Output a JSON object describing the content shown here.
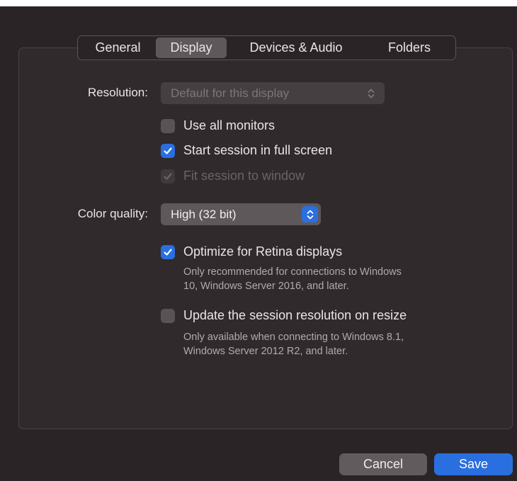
{
  "tabs": {
    "general": "General",
    "display": "Display",
    "devices_audio": "Devices & Audio",
    "folders": "Folders"
  },
  "resolution": {
    "label": "Resolution:",
    "value": "Default for this display"
  },
  "options": {
    "use_all_monitors": {
      "label": "Use all monitors",
      "checked": false
    },
    "start_full_screen": {
      "label": "Start session in full screen",
      "checked": true
    },
    "fit_to_window": {
      "label": "Fit session to window",
      "checked": true,
      "disabled": true
    }
  },
  "color_quality": {
    "label": "Color quality:",
    "value": "High (32 bit)"
  },
  "retina": {
    "label": "Optimize for Retina displays",
    "checked": true,
    "hint_line1": "Only recommended for connections to Windows",
    "hint_line2": "10, Windows Server 2016, and later."
  },
  "update_resolution": {
    "label": "Update the session resolution on resize",
    "checked": false,
    "hint_line1": "Only available when connecting to Windows 8.1,",
    "hint_line2": "Windows Server 2012 R2, and later."
  },
  "buttons": {
    "cancel": "Cancel",
    "save": "Save"
  },
  "colors": {
    "accent": "#2a6fe0",
    "background": "#2b2427"
  },
  "icons": {
    "checkmark": "checkmark-icon",
    "stepper": "chevron-up-down-icon"
  }
}
